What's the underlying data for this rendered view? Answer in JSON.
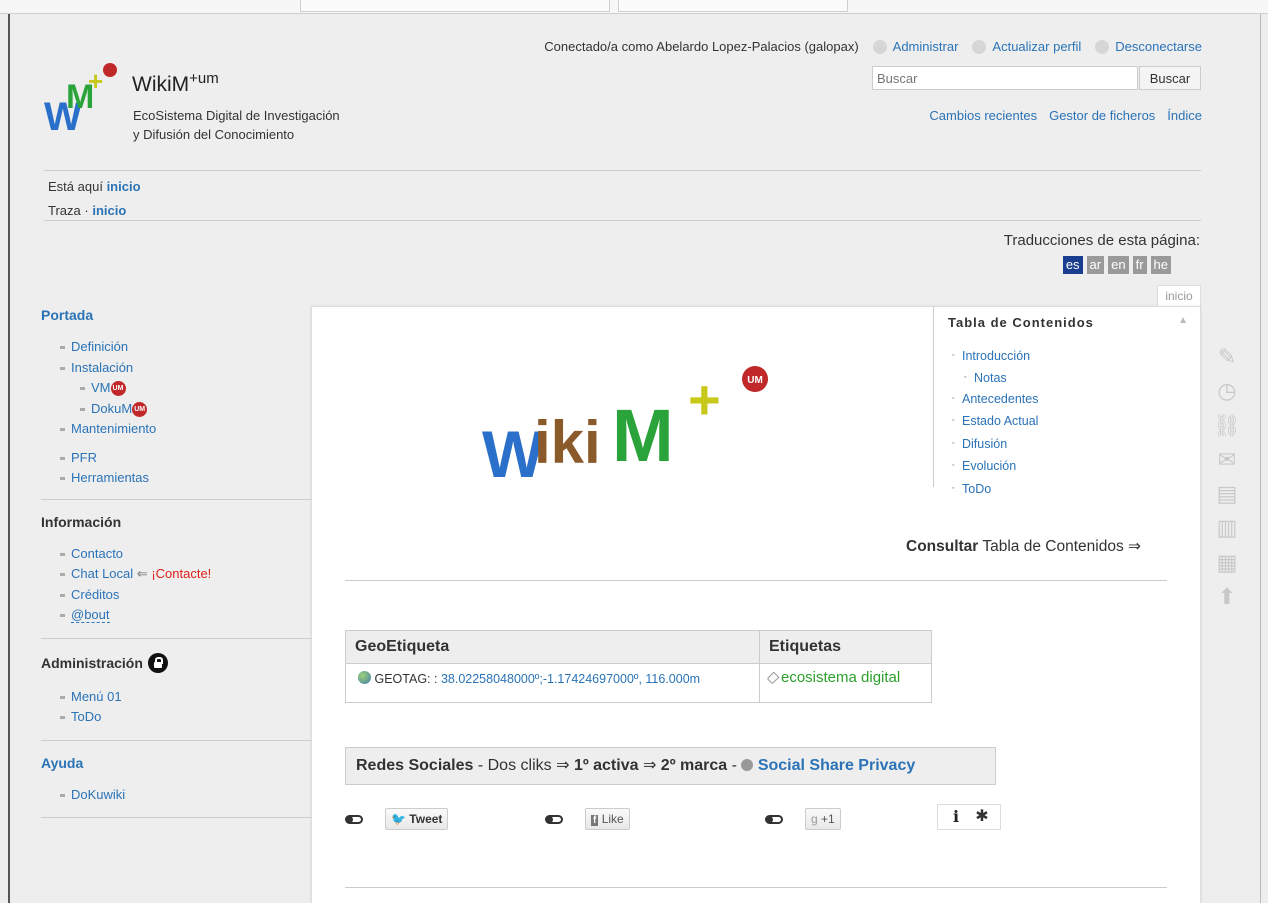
{
  "header": {
    "site_title": "WikiM",
    "site_title_sup": "+um",
    "tagline_line1": "EcoSistema Digital de Investigación",
    "tagline_line2": "y Difusión del Conocimiento"
  },
  "userbar": {
    "logged_in": "Conectado/a como Abelardo Lopez-Palacios (galopax)",
    "admin": "Administrar",
    "profile": "Actualizar perfil",
    "logout": "Desconectarse"
  },
  "search": {
    "placeholder": "Buscar",
    "button": "Buscar"
  },
  "sitetools": {
    "recent": "Cambios recientes",
    "media": "Gestor de ficheros",
    "index": "Índice"
  },
  "breadcrumbs": {
    "youarehere_label": "Está aquí",
    "youarehere_link": "inicio",
    "trace_label": "Traza ·",
    "trace_link": "inicio"
  },
  "translations": {
    "title": "Traducciones de esta página:",
    "langs": [
      "es",
      "ar",
      "en",
      "fr",
      "he"
    ],
    "active": "es"
  },
  "sidebar": {
    "portada": {
      "title": "Portada",
      "items": [
        "Definición",
        "Instalación",
        "VM",
        "DokuM",
        "Mantenimiento",
        "PFR",
        "Herramientas"
      ]
    },
    "informacion": {
      "title": "Información",
      "contacto": "Contacto",
      "chat": "Chat Local",
      "chat_arrow": "⇐",
      "chat_call": "¡Contacte!",
      "creditos": "Créditos",
      "about": "@bout"
    },
    "administracion": {
      "title": "Administración",
      "items": [
        "Menú 01",
        "ToDo"
      ]
    },
    "ayuda": {
      "title": "Ayuda",
      "items": [
        "DoKuwiki"
      ]
    },
    "um_badge": "UM"
  },
  "page": {
    "pagename": "inicio",
    "logo_text_w": "W",
    "logo_text_iki": "iki",
    "logo_text_m": "M",
    "logo_badge": "UM",
    "toc": {
      "title": "Tabla de Contenidos",
      "items": [
        "Introducción",
        "Notas",
        "Antecedentes",
        "Estado Actual",
        "Difusión",
        "Evolución",
        "ToDo"
      ]
    },
    "consult": {
      "bold": "Consultar",
      "rest": "Tabla de Contenidos ⇒"
    },
    "geo_table": {
      "col1": "GeoEtiqueta",
      "col2": "Etiquetas",
      "geotag_label": "GEOTAG: :",
      "geotag_value": "38.02258048000º;-1.17424697000º, 116.000m",
      "tag": "ecosistema digital"
    },
    "social": {
      "prefix": "Redes Sociales",
      "dash1": " - Dos cliks ⇒ ",
      "first": "1º activa",
      "arrow": " ⇒ ",
      "second": "2º marca",
      "dash2": " - ",
      "ssp": "Social Share Privacy",
      "tweet": "Tweet",
      "like": "Like",
      "gplus": "+1",
      "info": "i"
    }
  },
  "colors": {
    "link": "#2b73b7",
    "active_lang": "#1a3d8f",
    "green_tag": "#2ca02c",
    "red_call": "#e0201b",
    "logo_blue": "#2a6fc9",
    "logo_brown": "#8b5a2b",
    "logo_green": "#2aa43a",
    "logo_yellow": "#c8c81a",
    "logo_red": "#c0282a"
  },
  "pagetools_icons": [
    "edit-icon",
    "revisions-icon",
    "backlinks-icon",
    "email-icon",
    "translate-icon",
    "export-odt-icon",
    "export-pdf-icon",
    "back-to-top-icon"
  ]
}
